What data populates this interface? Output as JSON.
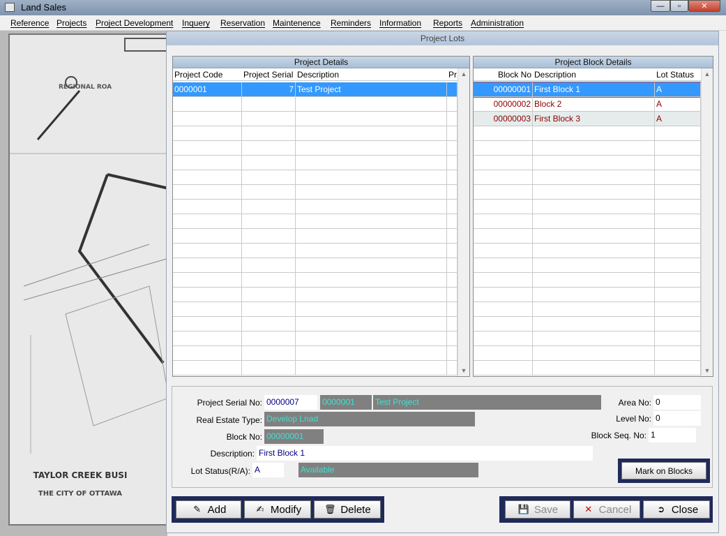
{
  "window": {
    "title": "Land Sales",
    "minimize": "—",
    "maximize": "▫",
    "close": "✕"
  },
  "menu": [
    "Reference",
    "Projects",
    "Project Development",
    "Inquery",
    "Reservation",
    "Maintenence",
    "Reminders",
    "Information",
    "Reports",
    "Administration"
  ],
  "background_map": {
    "road_label": "REGIONAL ROA",
    "title": "TAYLOR CREEK BUSI",
    "subtitle": "THE CITY OF OTTAWA"
  },
  "inner_window": {
    "title": "Project Lots"
  },
  "project_details": {
    "title": "Project Details",
    "columns": [
      "Project Code",
      "Project Serial",
      "Description",
      "Pr"
    ],
    "rows": [
      {
        "code": "0000001",
        "serial": "7",
        "description": "Test Project",
        "pr": ""
      }
    ]
  },
  "block_details": {
    "title": "Project Block Details",
    "columns": [
      "Block No",
      "Description",
      "Lot Status"
    ],
    "rows": [
      {
        "block_no": "00000001",
        "description": "First Block 1",
        "lot_status": "A"
      },
      {
        "block_no": "00000002",
        "description": "Block 2",
        "lot_status": "A"
      },
      {
        "block_no": "00000003",
        "description": "First Block 3",
        "lot_status": "A"
      }
    ]
  },
  "form": {
    "project_serial_label": "Project Serial No:",
    "project_serial_value": "0000007",
    "project_code_value": "0000001",
    "project_desc_value": "Test Project",
    "real_estate_label": "Real Estate Type:",
    "real_estate_value": "Develop Lnad",
    "block_no_label": "Block No:",
    "block_no_value": "00000001",
    "description_label": "Description:",
    "description_value": "First Block 1",
    "lot_status_label": "Lot Status(R/A):",
    "lot_status_value": "A",
    "lot_status_text": "Available",
    "area_no_label": "Area No:",
    "area_no_value": "0",
    "level_no_label": "Level No:",
    "level_no_value": "0",
    "block_seq_label": "Block Seq. No:",
    "block_seq_value": "1"
  },
  "buttons": {
    "mark_on_blocks": "Mark on Blocks",
    "add": "Add",
    "modify": "Modify",
    "delete": "Delete",
    "save": "Save",
    "cancel": "Cancel",
    "close": "Close"
  },
  "colors": {
    "selection": "#3399ff",
    "grey_field": "#808080",
    "cyan_text": "#40e0d0",
    "frame_navy": "#1f2a5a"
  }
}
